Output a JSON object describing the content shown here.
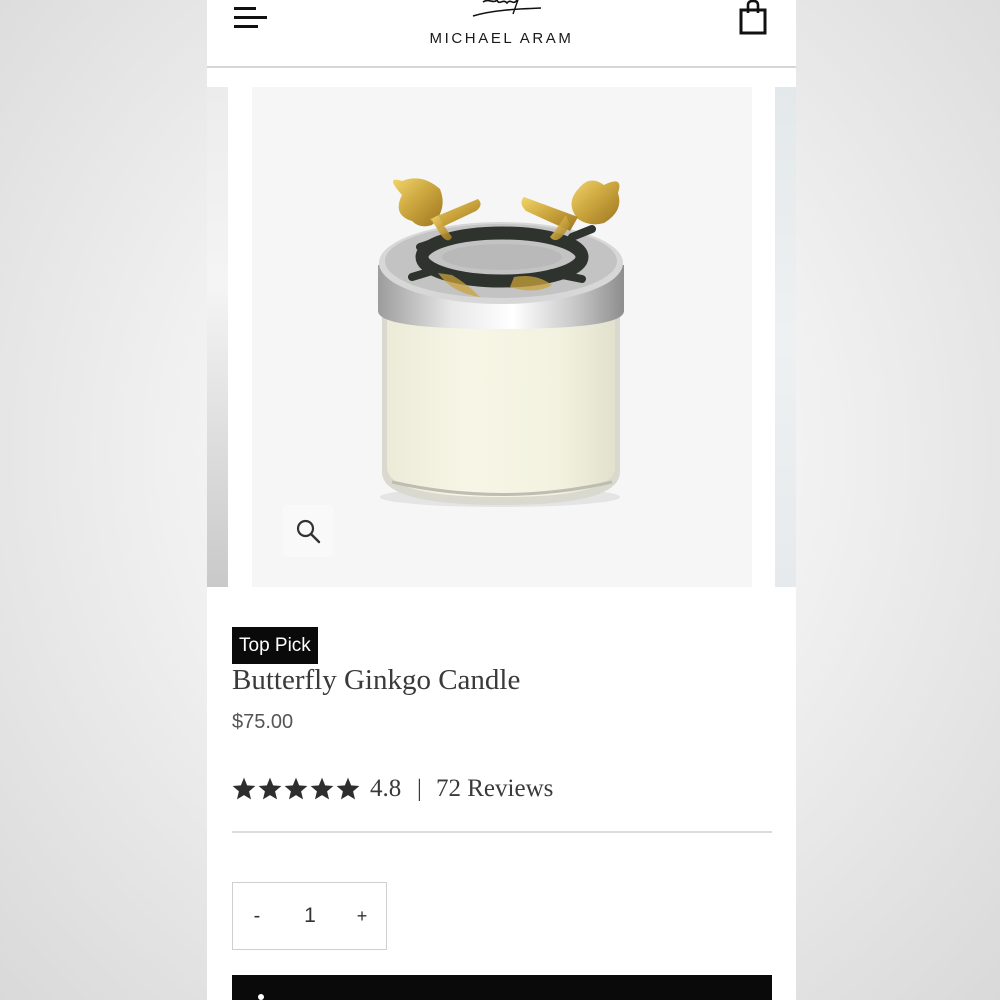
{
  "header": {
    "brand_name": "MICHAEL ARAM",
    "menu_icon": "hamburger-menu-icon",
    "cart_icon": "shopping-bag-icon"
  },
  "gallery": {
    "zoom_icon": "magnifier-icon"
  },
  "product": {
    "badge": "Top Pick",
    "title": "Butterfly Ginkgo Candle",
    "price": "$75.00",
    "rating": {
      "stars": 5,
      "value": "4.8",
      "separator": "|",
      "reviews_label": "72 Reviews"
    },
    "quantity": {
      "minus_label": "-",
      "value": "1",
      "plus_label": "+"
    }
  },
  "colors": {
    "text": "#3a3a3a",
    "badge_bg": "#0a0a0a",
    "gold": "#c9a33c",
    "divider": "#dcdcdc"
  }
}
